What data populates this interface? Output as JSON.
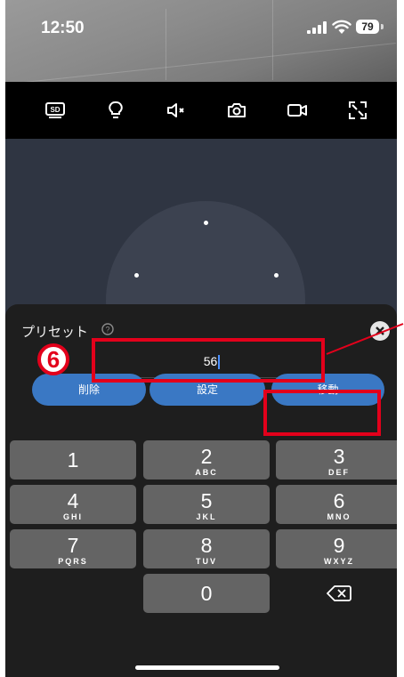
{
  "status_bar": {
    "time": "12:50",
    "battery": "79"
  },
  "toolbar": {
    "sd_label": "SD",
    "icons": [
      "sd-card-icon",
      "light-bulb-icon",
      "mute-icon",
      "camera-icon",
      "video-record-icon",
      "fullscreen-icon"
    ]
  },
  "preset": {
    "title": "プリセット",
    "value": "56",
    "delete_label": "削除",
    "set_label": "設定",
    "move_label": "移動"
  },
  "annotation": {
    "step_number": "6"
  },
  "keypad": {
    "keys": [
      {
        "num": "1",
        "letters": ""
      },
      {
        "num": "2",
        "letters": "ABC"
      },
      {
        "num": "3",
        "letters": "DEF"
      },
      {
        "num": "4",
        "letters": "GHI"
      },
      {
        "num": "5",
        "letters": "JKL"
      },
      {
        "num": "6",
        "letters": "MNO"
      },
      {
        "num": "7",
        "letters": "PQRS"
      },
      {
        "num": "8",
        "letters": "TUV"
      },
      {
        "num": "9",
        "letters": "WXYZ"
      },
      {
        "num": "0",
        "letters": ""
      }
    ]
  },
  "colors": {
    "accent_button": "#3a78c4",
    "annotation_red": "#e3001b",
    "sheet_bg": "#1e1e1e",
    "key_bg": "#646464"
  }
}
